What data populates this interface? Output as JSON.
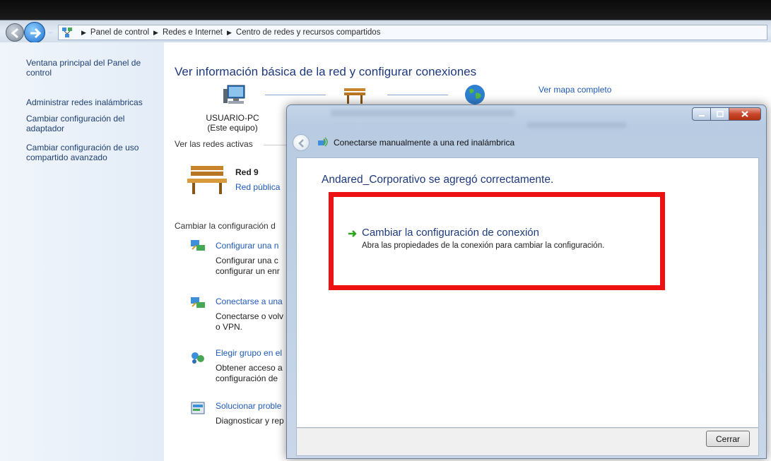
{
  "address_bar": {
    "crumbs": [
      "Panel de control",
      "Redes e Internet",
      "Centro de redes y recursos compartidos"
    ]
  },
  "left_pane": {
    "links": [
      "Ventana principal del Panel de control",
      "Administrar redes inalámbricas",
      "Cambiar configuración del adaptador",
      "Cambiar configuración de uso compartido avanzado"
    ]
  },
  "main": {
    "title": "Ver información básica de la red y configurar conexiones",
    "map_link": "Ver mapa completo",
    "pc_name": "USUARIO-PC",
    "pc_desc": "(Este equipo)",
    "active_networks_label": "Ver las redes activas",
    "network": {
      "name": "Red 9",
      "type": "Red pública"
    },
    "change_settings_label": "Cambiar la configuración d",
    "tasks": [
      {
        "link": "Configurar una n",
        "desc": [
          "Configurar una c",
          "configurar un enr"
        ]
      },
      {
        "link": "Conectarse a una",
        "desc": [
          "Conectarse o volv",
          "o VPN."
        ]
      },
      {
        "link": "Elegir grupo en el",
        "desc": [
          "Obtener acceso a",
          "configuración de"
        ]
      },
      {
        "link": "Solucionar proble",
        "desc": [
          "Diagnosticar y rep"
        ]
      }
    ]
  },
  "dialog": {
    "wizard_title": "Conectarse manualmente a una red inalámbrica",
    "success_message": "Andared_Corporativo se agregó correctamente.",
    "command_title": "Cambiar la configuración de conexión",
    "command_desc": "Abra las propiedades de la conexión para cambiar la configuración.",
    "close_button": "Cerrar",
    "highlight_color": "#ee1111"
  }
}
